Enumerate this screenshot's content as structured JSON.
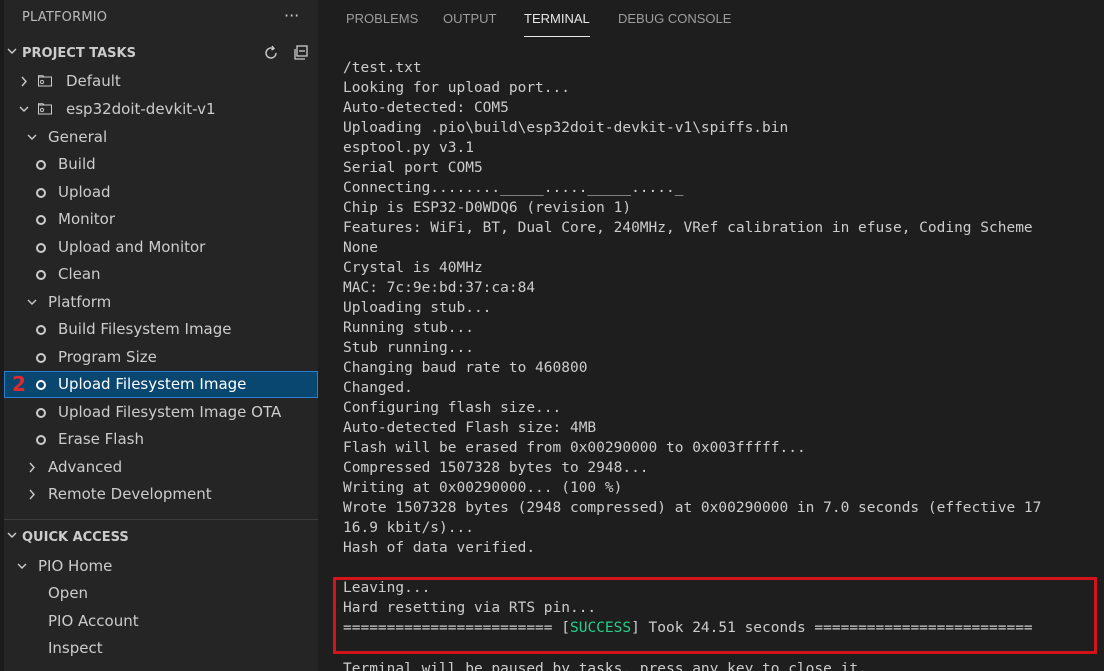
{
  "sidebar": {
    "title": "PLATFORMIO",
    "more_icon": "ellipsis-icon",
    "project_tasks": {
      "label": "PROJECT TASKS",
      "refresh_icon": "refresh-icon",
      "collapse_icon": "collapse-all-icon"
    },
    "tree": {
      "default": "Default",
      "env": "esp32doit-devkit-v1",
      "general": "General",
      "general_items": [
        "Build",
        "Upload",
        "Monitor",
        "Upload and Monitor",
        "Clean"
      ],
      "platform": "Platform",
      "platform_items": [
        "Build Filesystem Image",
        "Program Size",
        "Upload Filesystem Image",
        "Upload Filesystem Image OTA",
        "Erase Flash"
      ],
      "advanced": "Advanced",
      "remote": "Remote Development"
    },
    "annotation_number": "2",
    "quick_access": {
      "label": "QUICK ACCESS",
      "pio_home": "PIO Home",
      "items": [
        "Open",
        "PIO Account",
        "Inspect"
      ]
    }
  },
  "panel": {
    "tabs": [
      "PROBLEMS",
      "OUTPUT",
      "TERMINAL",
      "DEBUG CONSOLE"
    ],
    "active_tab": "TERMINAL",
    "terminal_lines": [
      "/test.txt",
      "Looking for upload port...",
      "Auto-detected: COM5",
      "Uploading .pio\\build\\esp32doit-devkit-v1\\spiffs.bin",
      "esptool.py v3.1",
      "Serial port COM5",
      "Connecting........_____....._____....._",
      "Chip is ESP32-D0WDQ6 (revision 1)",
      "Features: WiFi, BT, Dual Core, 240MHz, VRef calibration in efuse, Coding Scheme",
      "None",
      "Crystal is 40MHz",
      "MAC: 7c:9e:bd:37:ca:84",
      "Uploading stub...",
      "Running stub...",
      "Stub running...",
      "Changing baud rate to 460800",
      "Changed.",
      "Configuring flash size...",
      "Auto-detected Flash size: 4MB",
      "Flash will be erased from 0x00290000 to 0x003fffff...",
      "Compressed 1507328 bytes to 2948...",
      "Writing at 0x00290000... (100 %)",
      "Wrote 1507328 bytes (2948 compressed) at 0x00290000 in 7.0 seconds (effective 17",
      "16.9 kbit/s)...",
      "Hash of data verified.",
      "",
      "Leaving...",
      "Hard resetting via RTS pin..."
    ],
    "success_line": {
      "prefix": "======================== [",
      "status": "SUCCESS",
      "suffix": "] Took 24.51 seconds ========================="
    },
    "bottom_line": "Terminal will be paused by tasks, press any key to close it.",
    "colors": {
      "success": "#23d18b",
      "highlight_box": "#d3141a",
      "selected_row": "#094771"
    }
  }
}
